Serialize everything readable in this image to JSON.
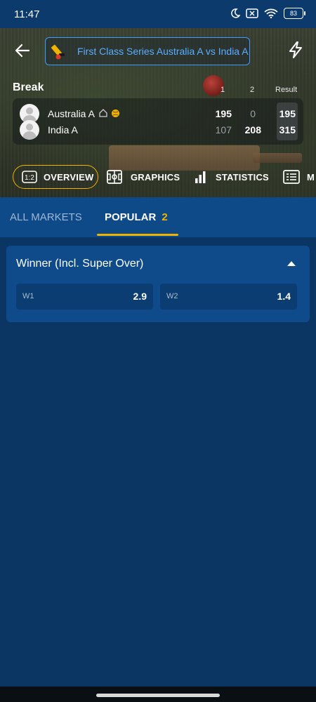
{
  "status_bar": {
    "time": "11:47",
    "battery": "83"
  },
  "header": {
    "match_title": "First Class Series Australia A vs India A",
    "state": "Break",
    "columns": [
      "1",
      "2",
      "Result"
    ]
  },
  "teams": [
    {
      "name": "Australia A",
      "scores": [
        "195",
        "0"
      ],
      "result": "195",
      "home": true,
      "batting": true
    },
    {
      "name": "India A",
      "scores": [
        "107",
        "208"
      ],
      "result": "315",
      "home": false,
      "batting": false
    }
  ],
  "nav_tabs": [
    {
      "label": "OVERVIEW",
      "icon": "score-icon",
      "active": true
    },
    {
      "label": "GRAPHICS",
      "icon": "field-icon",
      "active": false
    },
    {
      "label": "STATISTICS",
      "icon": "bar-chart-icon",
      "active": false
    },
    {
      "label": "M",
      "icon": "list-icon",
      "active": false
    }
  ],
  "market_tabs": {
    "all": "ALL MARKETS",
    "popular": "POPULAR",
    "popular_count": "2"
  },
  "market": {
    "title": "Winner (Incl. Super Over)",
    "odds": [
      {
        "label": "W1",
        "value": "2.9"
      },
      {
        "label": "W2",
        "value": "1.4"
      }
    ]
  },
  "colors": {
    "accent": "#f0b400",
    "link": "#5aaeff",
    "background": "#0b3563",
    "card": "#0f4b8a"
  }
}
